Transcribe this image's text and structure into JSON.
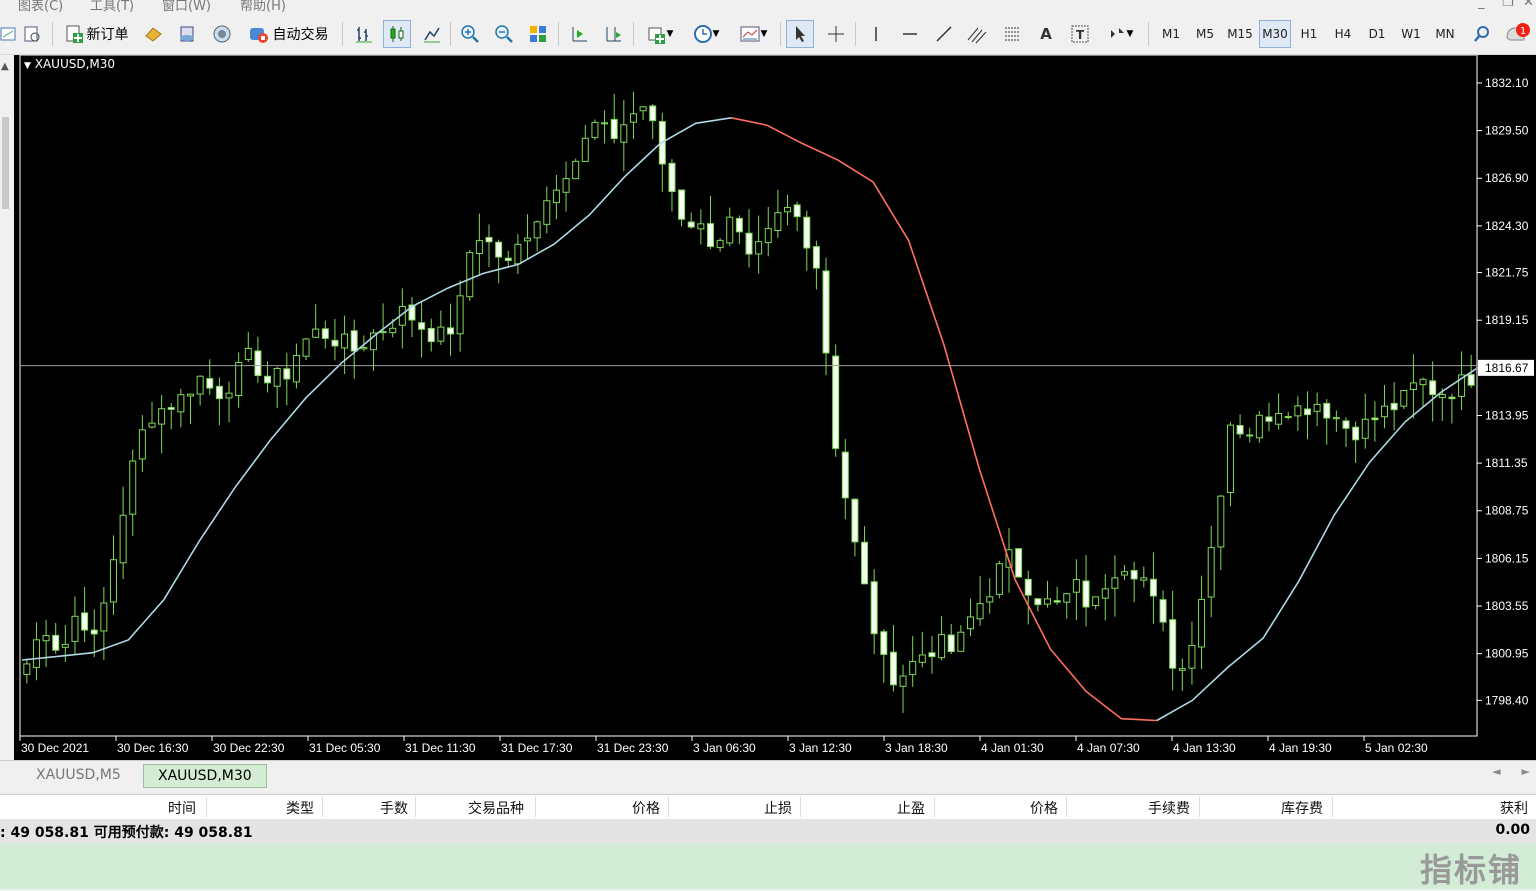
{
  "menu": {
    "items": [
      "图表(C)",
      "工具(T)",
      "窗口(W)",
      "帮助(H)"
    ]
  },
  "toolbar": {
    "new_order_label": "新订单",
    "auto_trade_label": "自动交易",
    "timeframes": [
      "M1",
      "M5",
      "M15",
      "M30",
      "H1",
      "H4",
      "D1",
      "W1",
      "MN"
    ],
    "active_timeframe": "M30",
    "notification_count": "1"
  },
  "chart": {
    "title": "XAUUSD,M30",
    "current_price_label": "1816.67",
    "colors": {
      "background": "#000000",
      "bull": "#7ed957",
      "ma_up": "#add8e6",
      "ma_down": "#ff6f61",
      "price_line": "#a0a0a0"
    }
  },
  "chart_data": {
    "type": "candlestick",
    "symbol": "XAUUSD",
    "timeframe": "M30",
    "ylim": [
      1797.0,
      1833.3
    ],
    "y_ticks": [
      "1832.10",
      "1829.50",
      "1826.90",
      "1824.30",
      "1821.75",
      "1819.15",
      "1816.67",
      "1813.95",
      "1811.35",
      "1808.75",
      "1806.15",
      "1803.55",
      "1800.95",
      "1798.40"
    ],
    "y_tick_values": [
      1832.1,
      1829.5,
      1826.9,
      1824.3,
      1821.75,
      1819.15,
      1816.55,
      1813.95,
      1811.35,
      1808.75,
      1806.15,
      1803.55,
      1800.95,
      1798.4
    ],
    "x_ticks": [
      "30 Dec 2021",
      "30 Dec 16:30",
      "30 Dec 22:30",
      "31 Dec 05:30",
      "31 Dec 11:30",
      "31 Dec 17:30",
      "31 Dec 23:30",
      "3 Jan 06:30",
      "3 Jan 12:30",
      "3 Jan 18:30",
      "4 Jan 01:30",
      "4 Jan 07:30",
      "4 Jan 13:30",
      "4 Jan 19:30",
      "5 Jan 02:30"
    ],
    "current_price": 1816.67,
    "close_path": [
      1800.4,
      1802.6,
      1800.9,
      1803.5,
      1801.4,
      1806.0,
      1810.6,
      1813.9,
      1814.4,
      1814.9,
      1816.1,
      1815.1,
      1815.9,
      1817.2,
      1815.8,
      1816.1,
      1817.9,
      1818.6,
      1818.1,
      1817.5,
      1818.3,
      1818.9,
      1819.7,
      1818.8,
      1818.2,
      1819.0,
      1824.1,
      1823.2,
      1822.1,
      1823.9,
      1825.3,
      1827.1,
      1828.0,
      1829.8,
      1829.1,
      1830.2,
      1831.0,
      1827.6,
      1825.0,
      1824.3,
      1823.4,
      1824.6,
      1822.2,
      1823.5,
      1825.3,
      1824.6,
      1822.0,
      1812.7,
      1807.5,
      1803.3,
      1799.8,
      1799.9,
      1800.9,
      1801.5,
      1801.0,
      1803.1,
      1804.5,
      1806.3,
      1805.0,
      1803.8,
      1803.5,
      1804.6,
      1803.3,
      1805.5,
      1806.0,
      1805.0,
      1802.5,
      1799.5,
      1802.7,
      1807.3,
      1813.6,
      1813.0,
      1813.9,
      1814.6,
      1814.3,
      1814.7,
      1814.0,
      1813.1,
      1813.5,
      1814.2,
      1814.7,
      1815.9,
      1815.2,
      1815.4,
      1816.1
    ],
    "ma_path": [
      1800.6,
      1800.8,
      1801.0,
      1801.7,
      1803.9,
      1807.1,
      1810.0,
      1812.6,
      1814.9,
      1816.8,
      1818.4,
      1819.9,
      1820.9,
      1821.7,
      1822.2,
      1823.3,
      1824.9,
      1827.0,
      1828.8,
      1829.9,
      1830.2,
      1829.8,
      1828.8,
      1827.9,
      1826.7,
      1823.5,
      1817.8,
      1811.0,
      1805.0,
      1801.2,
      1798.9,
      1797.4,
      1797.3,
      1798.4,
      1800.2,
      1801.8,
      1804.9,
      1808.5,
      1811.4,
      1813.6,
      1815.2,
      1816.5
    ],
    "ma_down_segment": "from 3 Jan 06:30 to 4 Jan 07:30"
  },
  "tabs": {
    "items": [
      "XAUUSD,M5",
      "XAUUSD,M30"
    ],
    "active": 1
  },
  "terminal": {
    "columns": [
      "时间",
      "类型",
      "手数",
      "交易品种",
      "价格",
      "止损",
      "止盈",
      "价格",
      "手续费",
      "库存费",
      "获利"
    ],
    "balance_text": ": 49 058.81  可用预付款: 49 058.81",
    "profit_total": "0.00"
  },
  "watermark": "指标铺"
}
